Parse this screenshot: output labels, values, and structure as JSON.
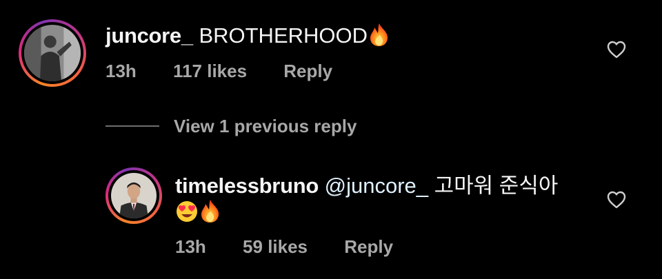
{
  "comments": [
    {
      "username": "juncore_",
      "text": "BROTHERHOOD",
      "emoji": [
        "fire"
      ],
      "time": "13h",
      "likes": "117 likes",
      "reply_label": "Reply",
      "avatar_icon": "shirtless-person-photo",
      "action_icon": "heart-outline-icon"
    },
    {
      "username": "timelessbruno",
      "mention": "@juncore_",
      "text": "고마워 준식아",
      "emoji": [
        "heart-eyes",
        "fire"
      ],
      "time": "13h",
      "likes": "59 likes",
      "reply_label": "Reply",
      "avatar_icon": "suited-man-photo",
      "action_icon": "heart-outline-icon"
    }
  ],
  "view_previous": {
    "label": "View 1 previous reply"
  },
  "colors": {
    "background": "#000000",
    "primary_text": "#f5f5f5",
    "secondary_text": "#a8a8a8",
    "story_ring": [
      "#f58529",
      "#dd2a7b",
      "#8134af"
    ]
  }
}
